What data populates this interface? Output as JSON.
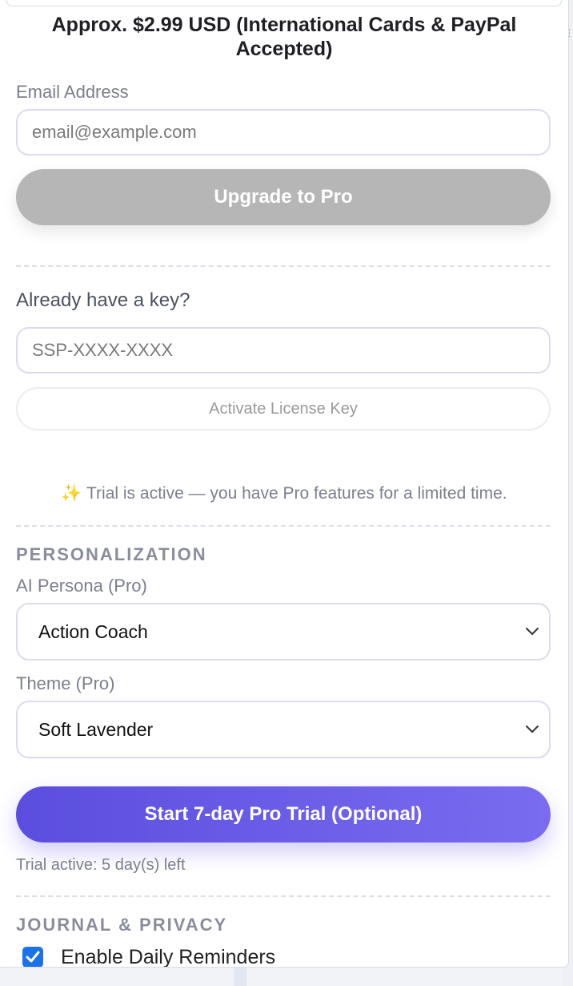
{
  "pricing": {
    "approx_line": "Approx. $2.99 USD (International Cards & PayPal Accepted)"
  },
  "email": {
    "label": "Email Address",
    "placeholder": "email@example.com",
    "value": ""
  },
  "upgrade": {
    "button_label": "Upgrade to Pro"
  },
  "license": {
    "heading": "Already have a key?",
    "placeholder": "SSP-XXXX-XXXX",
    "value": "",
    "activate_label": "Activate License Key"
  },
  "trial_notice": "✨ Trial is active — you have Pro features for a limited time.",
  "personalization": {
    "title": "PERSONALIZATION",
    "persona_label": "AI Persona (Pro)",
    "persona_value": "Action Coach",
    "theme_label": "Theme (Pro)",
    "theme_value": "Soft Lavender"
  },
  "trial": {
    "button_label": "Start 7-day Pro Trial (Optional)",
    "status": "Trial active: 5 day(s) left"
  },
  "journal": {
    "title": "JOURNAL & PRIVACY",
    "daily_reminders_label": "Enable Daily Reminders",
    "daily_reminders_checked": true
  },
  "colors": {
    "accent_start": "#5b4ede",
    "accent_end": "#7a6cf0",
    "disabled_button": "#b6b6b6",
    "checkbox": "#1a73e8"
  }
}
